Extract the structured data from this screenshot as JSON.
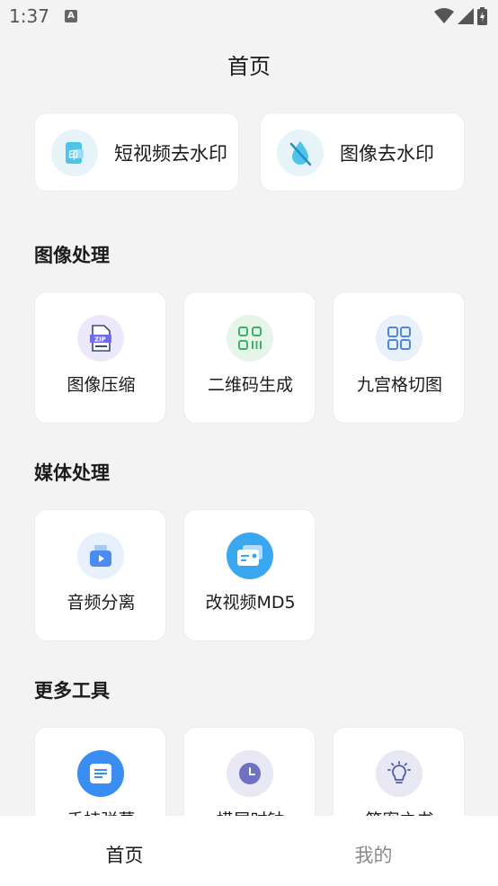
{
  "status_bar": {
    "time": "1:37",
    "notification_glyph": "A"
  },
  "header": {
    "title": "首页"
  },
  "top_tools": [
    {
      "label": "短视频去水印",
      "icon": "video-watermark-icon"
    },
    {
      "label": "图像去水印",
      "icon": "image-watermark-icon"
    }
  ],
  "sections": [
    {
      "title": "图像处理",
      "items": [
        {
          "label": "图像压缩",
          "icon": "zip-file-icon"
        },
        {
          "label": "二维码生成",
          "icon": "qr-code-icon"
        },
        {
          "label": "九宫格切图",
          "icon": "grid-icon"
        }
      ]
    },
    {
      "title": "媒体处理",
      "items": [
        {
          "label": "音频分离",
          "icon": "audio-separate-icon"
        },
        {
          "label": "改视频MD5",
          "icon": "video-md5-icon"
        }
      ]
    },
    {
      "title": "更多工具",
      "items": [
        {
          "label": "手持弹幕",
          "icon": "barrage-icon"
        },
        {
          "label": "横屏时钟",
          "icon": "clock-icon"
        },
        {
          "label": "答案之书",
          "icon": "bulb-icon"
        }
      ]
    }
  ],
  "bottom_nav": [
    {
      "label": "首页",
      "active": true
    },
    {
      "label": "我的",
      "active": false
    }
  ],
  "colors": {
    "active_nav": "#1b1b1b",
    "inactive_nav": "#8a8a8a",
    "accent_blue": "#3d8ff5"
  }
}
